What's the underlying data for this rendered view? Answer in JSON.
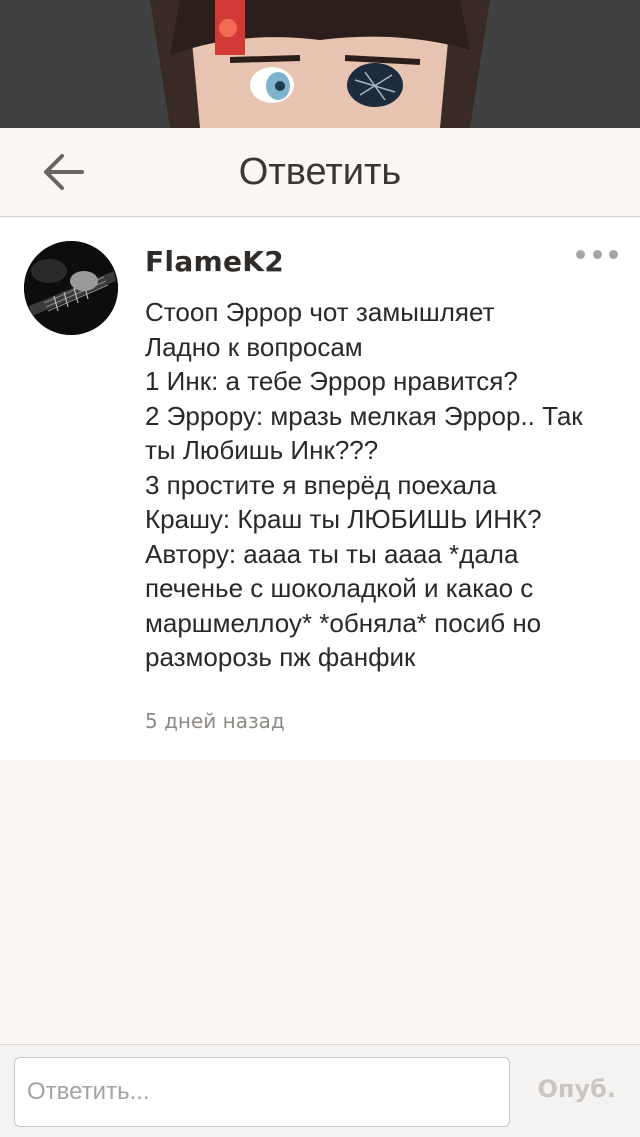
{
  "header": {
    "title": "Ответить"
  },
  "comment": {
    "username": "FlameK2",
    "lines": [
      "Стооп  Эррор чот замышляет",
      "Ладно к вопросам",
      "1 Инк:  а тебе Эррор нравится?",
      "2 Эррору: мразь мелкая Эррор..  Так",
      "ты Любишь Инк???",
      "3 простите я вперёд поехала",
      "Крашу:  Краш ты ЛЮБИШЬ ИНК?",
      "Автору:  аааа ты ты аааа *дала",
      "печенье с шоколадкой и какао с",
      "маршмеллоу* *обняла* посиб но",
      "разморозь пж фанфик"
    ],
    "timestamp": "5 дней назад"
  },
  "reply_bar": {
    "placeholder": "Ответить...",
    "publish_label": "Опуб."
  },
  "icons": {
    "back": "arrow-left-icon",
    "more": "more-horizontal-icon"
  },
  "colors": {
    "background": "#faf6f3",
    "card": "#ffffff",
    "publish_disabled": "#c9c6c3"
  }
}
